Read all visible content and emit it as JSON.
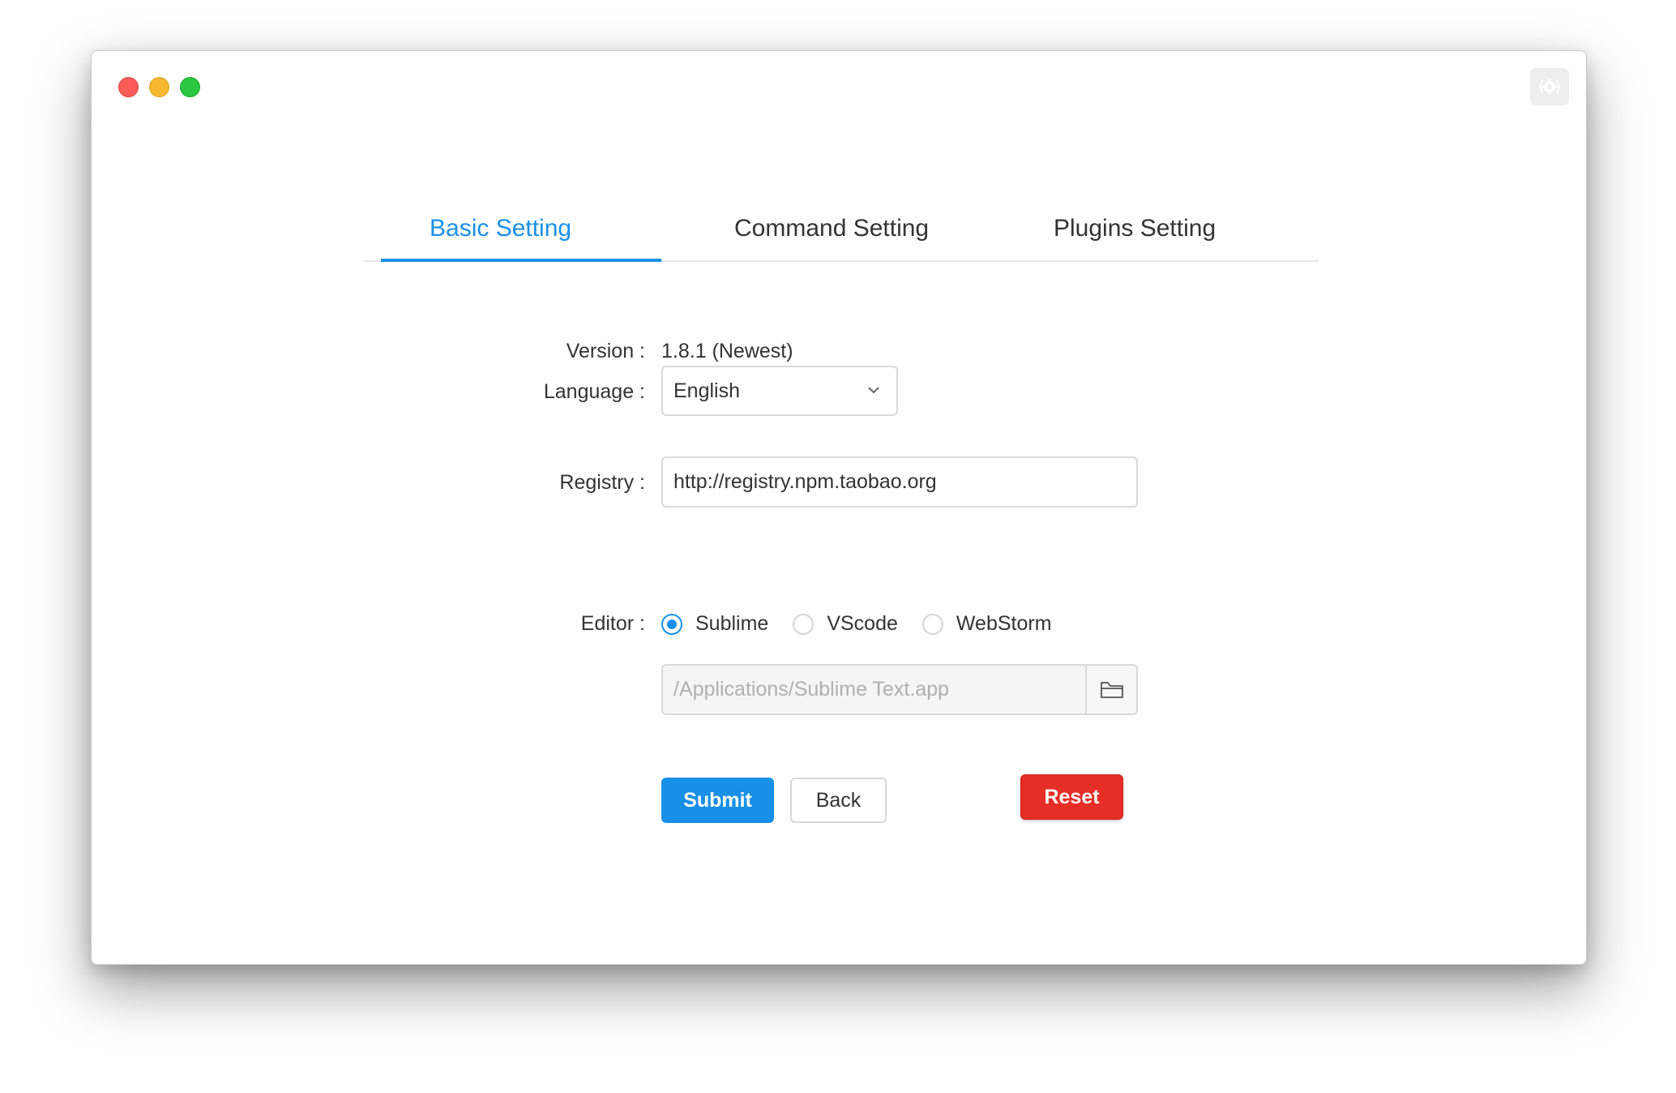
{
  "window": {
    "controls": [
      "close",
      "minimize",
      "maximize"
    ],
    "settings_icon": "gear-icon"
  },
  "tabs": [
    {
      "label": "Basic Setting",
      "active": true
    },
    {
      "label": "Command Setting",
      "active": false
    },
    {
      "label": "Plugins Setting",
      "active": false
    }
  ],
  "form": {
    "version": {
      "label": "Version :",
      "value": "1.8.1 (Newest)"
    },
    "language": {
      "label": "Language :",
      "selected": "English",
      "icon": "chevron-down-icon"
    },
    "registry": {
      "label": "Registry :",
      "value": "http://registry.npm.taobao.org"
    },
    "editor": {
      "label": "Editor :",
      "options": [
        {
          "label": "Sublime",
          "checked": true
        },
        {
          "label": "VScode",
          "checked": false
        },
        {
          "label": "WebStorm",
          "checked": false
        }
      ],
      "path": "/Applications/Sublime Text.app",
      "browse_icon": "folder-icon"
    }
  },
  "buttons": {
    "submit": "Submit",
    "back": "Back",
    "reset": "Reset"
  },
  "colors": {
    "primary": "#1890e8",
    "danger": "#e62e26",
    "text": "#333333",
    "border": "#d9d9d9"
  }
}
